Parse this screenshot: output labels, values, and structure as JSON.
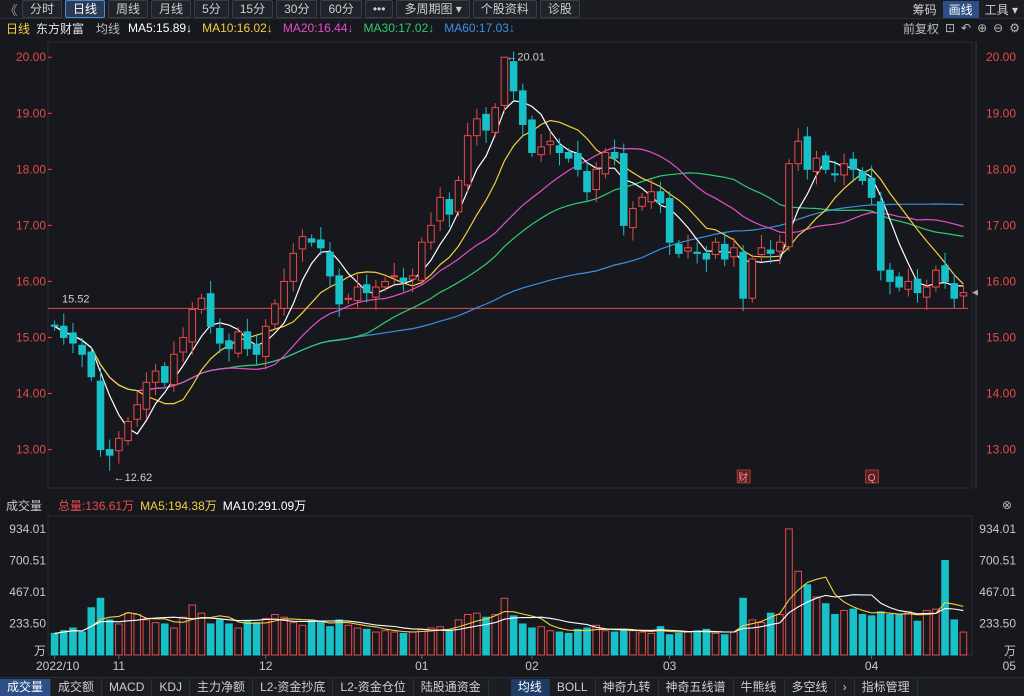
{
  "toolbar": {
    "back": "《",
    "periods": [
      "分时",
      "日线",
      "周线",
      "月线",
      "5分",
      "15分",
      "30分",
      "60分",
      "•••",
      "多周期图 ▾",
      "个股资料",
      "诊股"
    ],
    "active": 1,
    "right": [
      "筹码",
      "画线",
      "工具 ▾"
    ],
    "right_active": 1
  },
  "info": {
    "period": "日线",
    "stock": "东方财富",
    "label": "均线",
    "ma": [
      {
        "text": "MA5:15.89↓",
        "color": "#ffffff"
      },
      {
        "text": "MA10:16.02↓",
        "color": "#f4d03f"
      },
      {
        "text": "MA20:16.44↓",
        "color": "#e44ec8"
      },
      {
        "text": "MA30:17.02↓",
        "color": "#2ecc71"
      },
      {
        "text": "MA60:17.03↓",
        "color": "#3d8fe0"
      }
    ],
    "adjust": "前复权"
  },
  "volume_info": {
    "title": "成交量",
    "total": "总量:136.61万",
    "ma5": "MA5:194.38万",
    "ma10": "MA10:291.09万"
  },
  "bottom_tabs": [
    "成交量",
    "成交额",
    "MACD",
    "KDJ",
    "主力净额",
    "L2-资金抄底",
    "L2-资金仓位",
    "陆股通资金"
  ],
  "bottom_tabs2": [
    "均线",
    "BOLL",
    "神奇九转",
    "神奇五线谱",
    "牛熊线",
    "多空线",
    "›",
    "指标管理"
  ],
  "colors": {
    "up": "#e84a4a",
    "down": "#18c0c8",
    "ma5": "#ffffff",
    "ma10": "#f4d03f",
    "ma20": "#e44ec8",
    "ma30": "#2ecc71",
    "ma60": "#3d8fe0"
  },
  "chart_data": {
    "type": "candlestick",
    "price_axis": {
      "ticks": [
        20.0,
        19.0,
        18.0,
        17.0,
        16.0,
        15.0,
        14.0,
        13.0
      ],
      "tick_labels": [
        "20.00",
        "19.00",
        "18.00",
        "17.00",
        "16.00",
        "15.00",
        "14.00",
        "13.00"
      ],
      "range": [
        12.35,
        20.2
      ]
    },
    "volume_axis": {
      "tick_labels": [
        "934.01",
        "700.51",
        "467.01",
        "233.50",
        "万"
      ],
      "ticks": [
        934.01,
        700.51,
        467.01,
        233.5
      ],
      "unit": "万",
      "range": [
        0,
        1000
      ]
    },
    "x_labels": [
      {
        "label": "2022/10",
        "index": 0
      },
      {
        "label": "11",
        "index": 7
      },
      {
        "label": "12",
        "index": 23
      },
      {
        "label": "01",
        "index": 40
      },
      {
        "label": "02",
        "index": 52
      },
      {
        "label": "03",
        "index": 67
      },
      {
        "label": "04",
        "index": 89
      },
      {
        "label": "05",
        "index": 104
      }
    ],
    "annotations": {
      "high": "20.01",
      "low": "12.62",
      "hline": "15.52"
    },
    "markers": [
      "财",
      "Q"
    ],
    "current_price": 15.8,
    "close": [
      15.2,
      15.0,
      14.9,
      14.7,
      14.3,
      13.0,
      12.9,
      13.2,
      13.5,
      13.8,
      14.2,
      14.4,
      14.2,
      14.7,
      15.0,
      15.5,
      15.7,
      15.2,
      14.9,
      14.8,
      15.1,
      14.8,
      14.7,
      15.2,
      15.6,
      16.0,
      16.5,
      16.8,
      16.7,
      16.6,
      16.1,
      15.6,
      15.7,
      15.9,
      15.8,
      15.9,
      16.0,
      16.1,
      16.0,
      16.1,
      16.7,
      17.0,
      17.5,
      17.2,
      17.8,
      18.6,
      18.9,
      18.7,
      19.1,
      20.0,
      19.4,
      18.8,
      18.3,
      18.4,
      18.5,
      18.3,
      18.2,
      18.0,
      17.6,
      18.0,
      18.3,
      18.2,
      17.0,
      17.3,
      17.5,
      17.6,
      17.4,
      16.7,
      16.5,
      16.6,
      16.5,
      16.4,
      16.7,
      16.4,
      16.6,
      15.7,
      16.4,
      16.6,
      16.5,
      16.7,
      18.1,
      18.5,
      18.0,
      18.2,
      18.0,
      17.9,
      18.1,
      18.0,
      17.8,
      17.5,
      16.2,
      16.0,
      15.9,
      16.0,
      15.8,
      15.9,
      16.2,
      16.0,
      15.7,
      15.8
    ],
    "volume": [
      160,
      180,
      200,
      170,
      350,
      420,
      260,
      230,
      310,
      300,
      260,
      240,
      230,
      200,
      280,
      370,
      310,
      230,
      260,
      230,
      200,
      250,
      240,
      270,
      300,
      280,
      240,
      220,
      260,
      250,
      210,
      260,
      220,
      200,
      190,
      170,
      180,
      170,
      160,
      170,
      190,
      200,
      210,
      180,
      260,
      300,
      310,
      280,
      300,
      420,
      290,
      230,
      200,
      210,
      180,
      170,
      160,
      190,
      200,
      220,
      180,
      170,
      190,
      180,
      170,
      160,
      210,
      150,
      160,
      170,
      180,
      190,
      160,
      150,
      170,
      420,
      260,
      240,
      310,
      300,
      934,
      620,
      520,
      430,
      380,
      300,
      330,
      340,
      300,
      290,
      320,
      300,
      300,
      320,
      250,
      330,
      340,
      700,
      260,
      170
    ]
  }
}
